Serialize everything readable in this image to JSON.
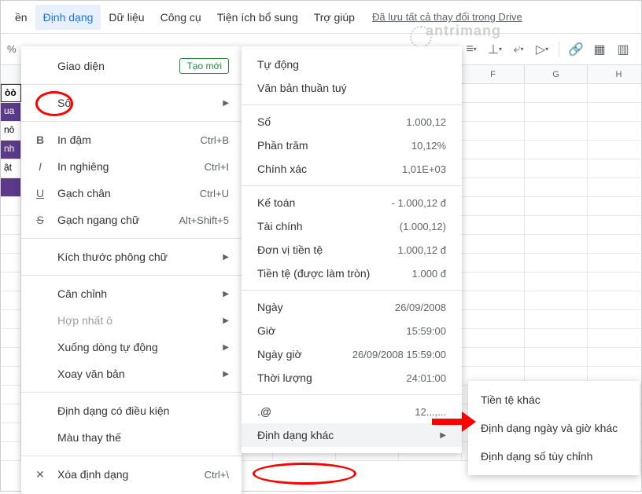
{
  "menubar": {
    "items": [
      "ền",
      "Định dạng",
      "Dữ liệu",
      "Công cụ",
      "Tiện ích bổ sung",
      "Trợ giúp"
    ],
    "active_index": 1,
    "save_status": "Đã lưu tất cả thay đổi trong Drive"
  },
  "toolbar": {
    "percent": "%"
  },
  "watermark": "antrimang",
  "format_menu": {
    "giao_dien": "Giao diện",
    "tao_moi": "Tạo mới",
    "so": "Số",
    "in_dam": "In đậm",
    "in_dam_sc": "Ctrl+B",
    "in_nghieng": "In nghiêng",
    "in_nghieng_sc": "Ctrl+I",
    "gach_chan": "Gạch chân",
    "gach_chan_sc": "Ctrl+U",
    "gach_ngang": "Gạch ngang chữ",
    "gach_ngang_sc": "Alt+Shift+5",
    "kich_thuoc": "Kích thước phông chữ",
    "can_chinh": "Căn chỉnh",
    "hop_nhat": "Hợp nhất ô",
    "xuong_dong": "Xuống dòng tự động",
    "xoay": "Xoay văn bản",
    "dd_co_dk": "Định dạng có điều kiện",
    "mau_thay_the": "Màu thay thế",
    "xoa_dd": "Xóa định dạng",
    "xoa_dd_sc": "Ctrl+\\"
  },
  "number_menu": {
    "tu_dong": "Tự động",
    "van_ban": "Văn bản thuần tuý",
    "so": "Số",
    "so_s": "1.000,12",
    "phan_tram": "Phần trăm",
    "phan_tram_s": "10,12%",
    "chinh_xac": "Chính xác",
    "chinh_xac_s": "1,01E+03",
    "ke_toan": "Kế toán",
    "ke_toan_s": "- 1.000,12 đ",
    "tai_chinh": "Tài chính",
    "tai_chinh_s": "(1.000,12)",
    "don_vi": "Đơn vị tiền tệ",
    "don_vi_s": "1.000,12 đ",
    "tien_te": "Tiền tệ (được làm tròn)",
    "tien_te_s": "1.000 đ",
    "ngay": "Ngày",
    "ngay_s": "26/09/2008",
    "gio": "Giờ",
    "gio_s": "15:59:00",
    "ngay_gio": "Ngày giờ",
    "ngay_gio_s": "26/09/2008 15:59:00",
    "thoi_luong": "Thời lượng",
    "thoi_luong_s": "24:01:00",
    "at": ".@",
    "at_s": "12...,...",
    "dd_khac": "Định dạng khác"
  },
  "more_menu": {
    "tien_te_khac": "Tiền tệ khác",
    "ngay_gio_khac": "Định dạng ngày và giờ khác",
    "so_tuy_chinh": "Định dạng số tùy chỉnh"
  },
  "cols": [
    "",
    "",
    "",
    "",
    "",
    "",
    "",
    "F",
    "G",
    "H"
  ],
  "sheet_rows": [
    {
      "label": "òò",
      "purple": false,
      "bold": true
    },
    {
      "label": "ua",
      "purple": true,
      "bold": false
    },
    {
      "label": "nô",
      "purple": false,
      "bold": false
    },
    {
      "label": "nh",
      "purple": true,
      "bold": false
    },
    {
      "label": "ật",
      "purple": false,
      "bold": false
    },
    {
      "label": "",
      "purple": true,
      "bold": false
    }
  ]
}
